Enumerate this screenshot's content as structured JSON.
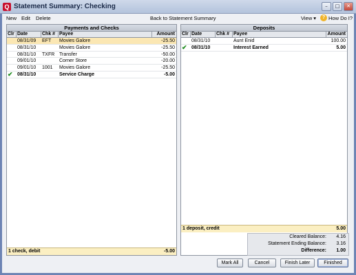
{
  "window": {
    "title": "Statement Summary: Checking",
    "app_icon": "Q"
  },
  "menubar": {
    "new": "New",
    "edit": "Edit",
    "delete": "Delete",
    "back": "Back to Statement Summary",
    "view": "View ▾",
    "howdoi": "How Do I?"
  },
  "payments": {
    "title": "Payments and Checks",
    "columns": {
      "clr": "Clr",
      "date": "Date",
      "chk": "Chk #",
      "payee": "Payee",
      "amount": "Amount"
    },
    "rows": [
      {
        "clr": "",
        "date": "08/31/09",
        "chk": "EFT",
        "payee": "Movies Galore",
        "amount": "-25.50"
      },
      {
        "clr": "",
        "date": "08/31/10",
        "chk": "",
        "payee": "Movies Galore",
        "amount": "-25.50"
      },
      {
        "clr": "",
        "date": "08/31/10",
        "chk": "TXFR",
        "payee": "Transfer",
        "amount": "-50.00"
      },
      {
        "clr": "",
        "date": "09/01/10",
        "chk": "",
        "payee": "Corner Store",
        "amount": "-20.00"
      },
      {
        "clr": "",
        "date": "09/01/10",
        "chk": "1001",
        "payee": "Movies Galore",
        "amount": "-25.50"
      },
      {
        "clr": "✔",
        "date": "08/31/10",
        "chk": "",
        "payee": "Service Charge",
        "amount": "-5.00"
      }
    ],
    "footer_label": "1 check, debit",
    "footer_total": "-5.00"
  },
  "deposits": {
    "title": "Deposits",
    "columns": {
      "clr": "Clr",
      "date": "Date",
      "chk": "Chk #",
      "payee": "Payee",
      "amount": "Amount"
    },
    "rows": [
      {
        "clr": "",
        "date": "08/31/10",
        "chk": "",
        "payee": "Aunt Enid",
        "amount": "100.00"
      },
      {
        "clr": "✔",
        "date": "08/31/10",
        "chk": "",
        "payee": "Interest Earned",
        "amount": "5.00"
      }
    ],
    "footer_label": "1 deposit, credit",
    "footer_total": "5.00"
  },
  "summary": {
    "cleared_label": "Cleared Balance:",
    "cleared": "4.16",
    "ending_label": "Statement Ending Balance:",
    "ending": "3.16",
    "difference_label": "Difference:",
    "difference": "1.00"
  },
  "buttons": {
    "mark_all": "Mark All",
    "cancel": "Cancel",
    "finish_later": "Finish Later",
    "finished": "Finished"
  }
}
